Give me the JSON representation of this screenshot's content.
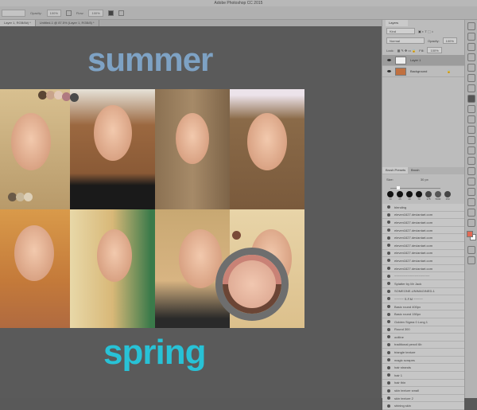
{
  "app": {
    "title": "Adobe Photoshop CC 2015"
  },
  "options": {
    "opacity_label": "Opacity:",
    "opacity": "100%",
    "flow_label": "Flow:",
    "flow": "100%"
  },
  "tabs": [
    {
      "label": "Layer 1, RGB/8#) *",
      "active": true
    },
    {
      "label": "Untitled-1 @ 87.5% (Layer 1, RGB/8) *",
      "active": false
    }
  ],
  "canvas": {
    "top_word": "summer",
    "bottom_word": "spring",
    "top_color": "#7ea2c4",
    "bottom_color": "#28c2d6"
  },
  "swatches": [
    "#5b4634",
    "#c9a48b",
    "#e3c9b8",
    "#b07a80",
    "#4a4a4a"
  ],
  "sampler_colors": {
    "current": "#c98276",
    "previous": "#6b4535"
  },
  "layers_panel": {
    "tab": "Layers",
    "kind_filter": "Kind",
    "blend_mode": "Normal",
    "opacity_label": "Opacity:",
    "opacity": "100%",
    "lock_label": "Lock:",
    "fill_label": "Fill:",
    "fill": "100%",
    "layers": [
      {
        "name": "Layer 1",
        "selected": true
      },
      {
        "name": "Background",
        "selected": false,
        "locked": true
      }
    ]
  },
  "brush_panel": {
    "tabs": [
      "Brush Presets",
      "Brush"
    ],
    "size_label": "Size:",
    "size": "30 px",
    "tip_sizes": [
      "30",
      "25",
      "40",
      "70",
      "175",
      "5000",
      "150"
    ],
    "items": [
      "blending",
      "eleven1627.deviantart.com",
      "eleven1627.deviantart.com",
      "eleven1627.deviantart.com",
      "eleven1627.deviantart.com",
      "eleven1627.deviantart.com",
      "eleven1627.deviantart.com",
      "eleven1627.deviantart.com",
      "eleven1627.deviantart.com",
      "~~~~~~~~~~~~~~~~~~~",
      "Splatter by Mr Jack",
      "SOMEONE-UNIMAGINED-1",
      "~~~~~ S.F.M ~~~~~",
      "Basic round 400px",
      "Basic round 150px",
      "Golden Sigma 0 Long 1",
      "Round 300",
      "outline",
      "traditional pencil 6b",
      "triangle texture",
      "magic scrapes",
      "hair strands",
      "hair 1",
      "hair thin",
      "skin texture small",
      "skin texture 2",
      "shining skin"
    ]
  },
  "colors": {
    "foreground": "#e06a55",
    "background": "#ffffff"
  }
}
